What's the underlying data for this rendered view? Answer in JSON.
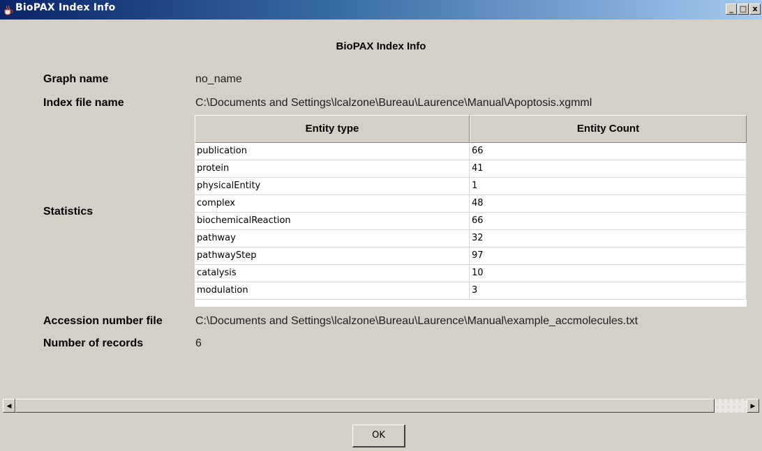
{
  "window": {
    "title": "BioPAX Index Info",
    "minimize_label": "_",
    "maximize_label": "□",
    "close_label": "x"
  },
  "dialog": {
    "heading": "BioPAX Index Info",
    "graph_name_label": "Graph name",
    "graph_name_value": "no_name",
    "index_file_label": "Index file name",
    "index_file_value": "C:\\Documents and Settings\\lcalzone\\Bureau\\Laurence\\Manual\\Apoptosis.xgmml",
    "statistics_label": "Statistics",
    "accession_label": "Accession number file",
    "accession_value": "C:\\Documents and Settings\\lcalzone\\Bureau\\Laurence\\Manual\\example_accmolecules.txt",
    "records_label": "Number of records",
    "records_value": "6"
  },
  "table": {
    "columns": [
      "Entity type",
      "Entity Count"
    ],
    "rows": [
      [
        "publication",
        "66"
      ],
      [
        "protein",
        "41"
      ],
      [
        "physicalEntity",
        "1"
      ],
      [
        "complex",
        "48"
      ],
      [
        "biochemicalReaction",
        "66"
      ],
      [
        "pathway",
        "32"
      ],
      [
        "pathwayStep",
        "97"
      ],
      [
        "catalysis",
        "10"
      ],
      [
        "modulation",
        "3"
      ]
    ]
  },
  "scrollbar": {
    "left_arrow": "◀",
    "right_arrow": "▶"
  },
  "buttons": {
    "ok_label": "OK"
  },
  "icons": {
    "app": "java-coffee-cup-icon"
  }
}
